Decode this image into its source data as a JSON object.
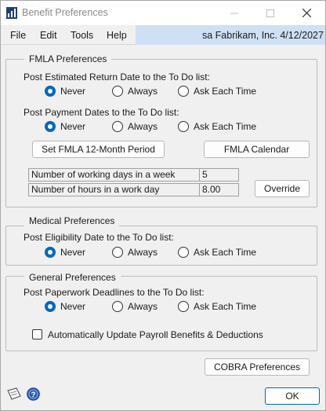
{
  "window": {
    "title": "Benefit Preferences"
  },
  "menu": {
    "items": [
      "File",
      "Edit",
      "Tools",
      "Help"
    ]
  },
  "userbar": {
    "text": "sa  Fabrikam, Inc.  4/12/2027"
  },
  "fmla": {
    "title": "FMLA Preferences",
    "return_label": "Post Estimated Return Date to the To Do list:",
    "payment_label": "Post Payment Dates to the To Do list:",
    "options": [
      "Never",
      "Always",
      "Ask Each Time"
    ],
    "return_selected": "Never",
    "payment_selected": "Never",
    "set_period_button": "Set FMLA 12-Month Period",
    "calendar_button": "FMLA Calendar",
    "working_days_label": "Number of working days in a week",
    "working_days_value": "5",
    "hours_label": "Number of hours in a work day",
    "hours_value": "8.00",
    "override_button": "Override"
  },
  "medical": {
    "title": "Medical Preferences",
    "eligibility_label": "Post Eligibility Date to the To Do list:",
    "options": [
      "Never",
      "Always",
      "Ask Each Time"
    ],
    "selected": "Never"
  },
  "general": {
    "title": "General Preferences",
    "paperwork_label": "Post Paperwork Deadlines to the To Do list:",
    "options": [
      "Never",
      "Always",
      "Ask Each Time"
    ],
    "selected": "Never",
    "auto_update_label": "Automatically Update Payroll Benefits & Deductions",
    "auto_update_checked": false
  },
  "footer": {
    "cobra_button": "COBRA Preferences",
    "ok_button": "OK"
  },
  "colors": {
    "accent": "#0067c0",
    "userbar": "#cfe0f5"
  },
  "icons": {
    "app": "chart-icon",
    "note": "note-icon",
    "help": "help-icon"
  }
}
